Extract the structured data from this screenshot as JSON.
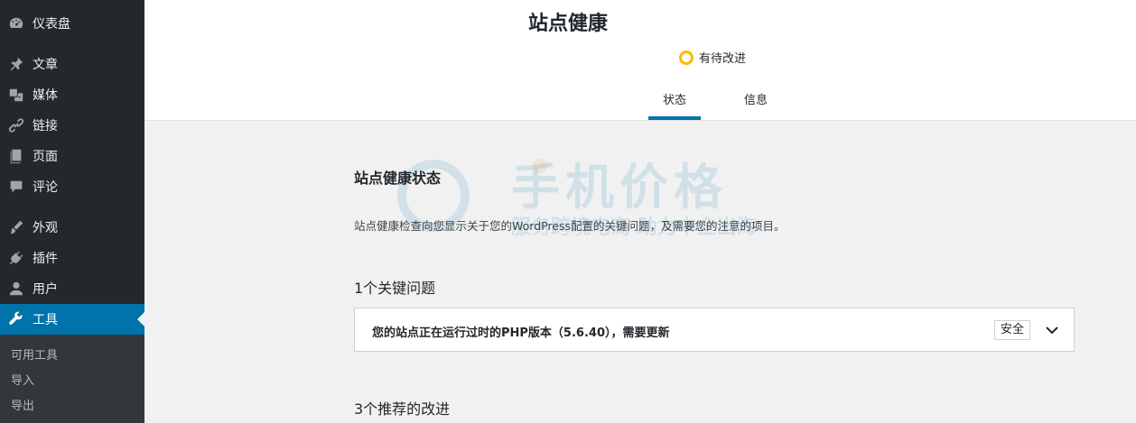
{
  "sidebar": {
    "items": [
      {
        "label": "仪表盘",
        "icon": "dashboard-icon"
      },
      {
        "label": "文章",
        "icon": "pin-icon"
      },
      {
        "label": "媒体",
        "icon": "media-icon"
      },
      {
        "label": "链接",
        "icon": "link-icon"
      },
      {
        "label": "页面",
        "icon": "page-icon"
      },
      {
        "label": "评论",
        "icon": "comment-icon"
      },
      {
        "label": "外观",
        "icon": "appearance-icon"
      },
      {
        "label": "插件",
        "icon": "plugin-icon"
      },
      {
        "label": "用户",
        "icon": "user-icon"
      },
      {
        "label": "工具",
        "icon": "wrench-icon",
        "active": true
      }
    ],
    "submenu": [
      "可用工具",
      "导入",
      "导出"
    ]
  },
  "header": {
    "title": "站点健康",
    "status_label": "有待改进",
    "status_color": "#ffb900",
    "tabs": [
      {
        "label": "状态",
        "active": true
      },
      {
        "label": "信息",
        "active": false
      }
    ]
  },
  "main": {
    "section_title": "站点健康状态",
    "description": "站点健康检查向您显示关于您的WordPress配置的关键问题，及需要您的注意的项目。",
    "critical_heading": "1个关键问题",
    "issues": [
      {
        "text": "您的站点正在运行过时的PHP版本（5.6.40），需要更新",
        "badge": "安全"
      }
    ],
    "recommended_heading": "3个推荐的改进"
  },
  "watermark": {
    "line1": "手机价格",
    "line2": "服务跨境电商 助力中企出海"
  },
  "colors": {
    "sidebar_bg": "#23282d",
    "active_bg": "#0073aa",
    "accent": "#0073aa"
  }
}
